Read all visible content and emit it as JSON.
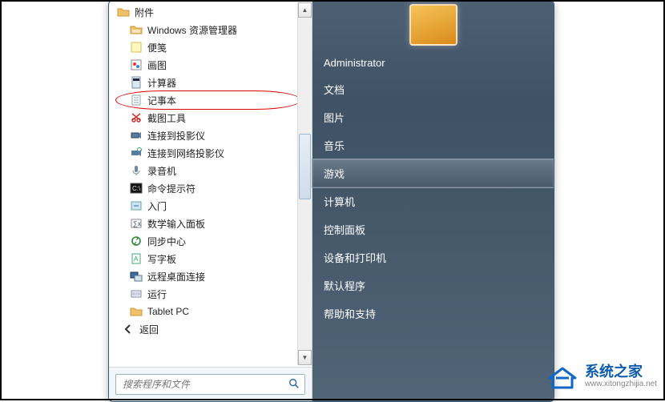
{
  "start_menu": {
    "accessories_folder_label": "附件",
    "programs": [
      {
        "icon": "explorer",
        "label": "Windows 资源管理器"
      },
      {
        "icon": "note-card",
        "label": "便笺"
      },
      {
        "icon": "paint",
        "label": "画图"
      },
      {
        "icon": "calculator",
        "label": "计算器"
      },
      {
        "icon": "notepad",
        "label": "记事本"
      },
      {
        "icon": "snip",
        "label": "截图工具"
      },
      {
        "icon": "projector",
        "label": "连接到投影仪"
      },
      {
        "icon": "net-projector",
        "label": "连接到网络投影仪"
      },
      {
        "icon": "recorder",
        "label": "录音机"
      },
      {
        "icon": "cmd",
        "label": "命令提示符"
      },
      {
        "icon": "getting-started",
        "label": "入门"
      },
      {
        "icon": "math-input",
        "label": "数学输入面板"
      },
      {
        "icon": "sync",
        "label": "同步中心"
      },
      {
        "icon": "wordpad",
        "label": "写字板"
      },
      {
        "icon": "rdc",
        "label": "远程桌面连接"
      },
      {
        "icon": "run",
        "label": "运行"
      },
      {
        "icon": "folder",
        "label": "Tablet PC"
      }
    ],
    "back_label": "返回",
    "highlighted_index": 4,
    "search_placeholder": "搜索程序和文件"
  },
  "right_pane": {
    "user": "Administrator",
    "items": [
      {
        "label": "文档",
        "selected": false
      },
      {
        "label": "图片",
        "selected": false
      },
      {
        "label": "音乐",
        "selected": false
      },
      {
        "label": "游戏",
        "selected": true
      },
      {
        "label": "计算机",
        "selected": false
      },
      {
        "label": "控制面板",
        "selected": false
      },
      {
        "label": "设备和打印机",
        "selected": false
      },
      {
        "label": "默认程序",
        "selected": false
      },
      {
        "label": "帮助和支持",
        "selected": false
      }
    ]
  },
  "watermark": {
    "title": "系统之家",
    "url": "www.xitongzhijia.net"
  },
  "icon_colors": {
    "folder": "#f2c268",
    "cmd_bg": "#111",
    "accent": "#2a6aa6"
  }
}
